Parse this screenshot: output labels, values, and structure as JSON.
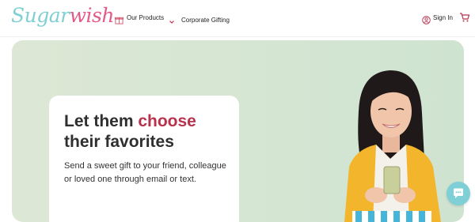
{
  "header": {
    "logo_part1": "Sugar",
    "logo_part2": "wish",
    "nav_products": "Our Products",
    "nav_corporate": "Corporate Gifting",
    "signin": "Sign In"
  },
  "hero": {
    "title_line1_prefix": "Let them ",
    "title_accent": "choose",
    "title_line2": "their favorites",
    "subtitle": "Send a sweet gift to your friend, colleague or loved one through email or text."
  },
  "icons": {
    "products": "gift-icon",
    "chevron": "chevron-down-icon",
    "user": "user-circle-icon",
    "cart": "cart-icon",
    "chat": "chat-icon"
  },
  "colors": {
    "logo_teal": "#7fcfd3",
    "logo_pink": "#e35a86",
    "accent_red": "#b8324d",
    "hero_bg": "#d6e6d3",
    "chat_teal": "#7ed0d6"
  }
}
